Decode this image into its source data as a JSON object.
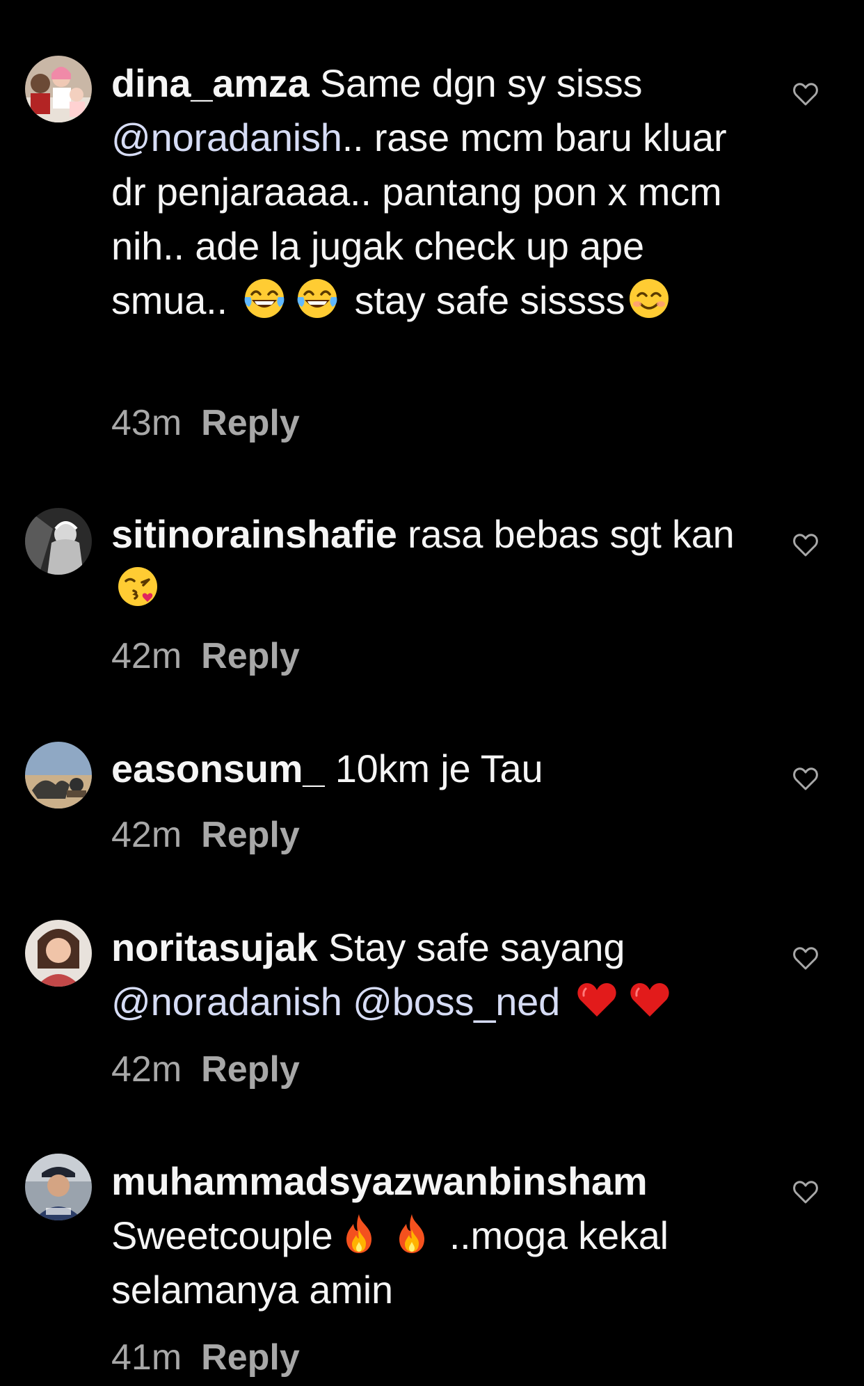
{
  "colors": {
    "background": "#000000",
    "text": "#f5f5f5",
    "mention": "#d6dcf5",
    "meta": "#a8a8a8"
  },
  "comments": [
    {
      "username": "dina_amza",
      "text_parts": [
        " Same dgn sy sisss ",
        "@noradanish",
        ".. rase mcm baru kluar dr penjaraaaa.. pantang pon x mcm nih.. ade la jugak check up ape smua.. ",
        " stay safe sissss"
      ],
      "emojis": [
        "tears-of-joy-emoji",
        "tears-of-joy-emoji",
        "smiling-face-emoji"
      ],
      "time": "43m",
      "reply_label": "Reply",
      "like_icon": "heart-outline-icon"
    },
    {
      "username": "sitinorainshafie",
      "text_parts": [
        " rasa bebas sgt kan "
      ],
      "emojis": [
        "kiss-face-emoji"
      ],
      "time": "42m",
      "reply_label": "Reply",
      "like_icon": "heart-outline-icon"
    },
    {
      "username": "easonsum_",
      "text_parts": [
        " 10km je Tau"
      ],
      "emojis": [],
      "time": "42m",
      "reply_label": "Reply",
      "like_icon": "heart-outline-icon"
    },
    {
      "username": "noritasujak",
      "text_parts": [
        " Stay safe sayang ",
        "@noradanish",
        " ",
        "@boss_ned",
        " "
      ],
      "emojis": [
        "red-heart-emoji",
        "red-heart-emoji"
      ],
      "time": "42m",
      "reply_label": "Reply",
      "like_icon": "heart-outline-icon"
    },
    {
      "username": "muhammadsyazwanbinsham",
      "text_parts": [
        " Sweetcouple",
        " ..moga kekal selamanya amin"
      ],
      "emojis": [
        "fire-emoji",
        "fire-emoji"
      ],
      "time": "41m",
      "reply_label": "Reply",
      "like_icon": "heart-outline-icon"
    }
  ]
}
